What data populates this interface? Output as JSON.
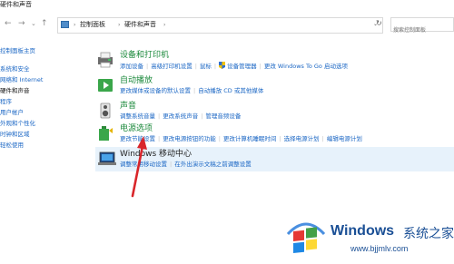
{
  "window": {
    "title": "硬件和声音"
  },
  "address": {
    "crumbs": [
      "控制面板",
      "硬件和声音"
    ],
    "search_placeholder": "搜索控制面板"
  },
  "sidebar": {
    "items": [
      {
        "label": "控制面板主页",
        "type": "link"
      },
      {
        "label": "系统和安全",
        "type": "link"
      },
      {
        "label": "网络和 Internet",
        "type": "link"
      },
      {
        "label": "硬件和声音",
        "type": "current"
      },
      {
        "label": "程序",
        "type": "link"
      },
      {
        "label": "用户帐户",
        "type": "link"
      },
      {
        "label": "外观和个性化",
        "type": "link"
      },
      {
        "label": "时钟和区域",
        "type": "link"
      },
      {
        "label": "轻松使用",
        "type": "link"
      }
    ]
  },
  "categories": [
    {
      "id": "devices",
      "title": "设备和打印机",
      "links": [
        "添加设备",
        "高级打印机设置",
        "鼠标",
        "设备管理器",
        "更改 Windows To Go 启动选项"
      ]
    },
    {
      "id": "autoplay",
      "title": "自动播放",
      "links": [
        "更改媒体或设备的默认设置",
        "自动播放 CD 或其他媒体"
      ]
    },
    {
      "id": "sound",
      "title": "声音",
      "links": [
        "调整系统音量",
        "更改系统声音",
        "管理音频设备"
      ]
    },
    {
      "id": "power",
      "title": "电源选项",
      "links": [
        "更改节能设置",
        "更改电源按钮的功能",
        "更改计算机睡眠时间",
        "选择电源计划",
        "编辑电源计划"
      ]
    },
    {
      "id": "mobility",
      "title": "Windows 移动中心",
      "links": [
        "调整常用移动设置",
        "在外出演示文稿之前调整设置"
      ]
    }
  ],
  "watermark": {
    "brand": "Windows",
    "cn": "系统之家",
    "url": "www.bjjmlv.com"
  },
  "colors": {
    "link": "#1a66c4",
    "title": "#1d8a3d",
    "highlight": "#e7f2fb",
    "arrow": "#d9262b"
  }
}
